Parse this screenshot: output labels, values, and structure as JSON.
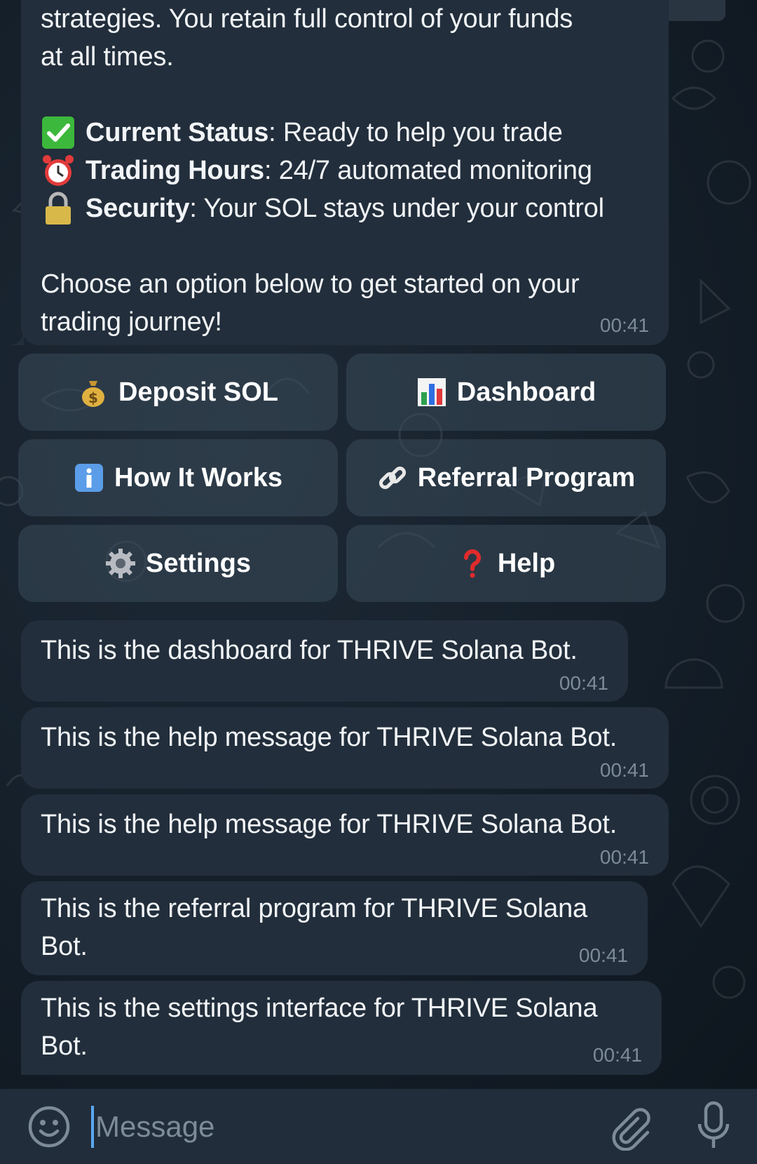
{
  "main_message": {
    "intro_line1": "strategies. You retain full control of your funds",
    "intro_line2": "at all times.",
    "status": [
      {
        "icon": "check-mark-icon",
        "label": "Current Status",
        "text": ": Ready to help you trade"
      },
      {
        "icon": "alarm-clock-icon",
        "label": "Trading Hours",
        "text": ": 24/7 automated monitoring"
      },
      {
        "icon": "lock-icon",
        "label": "Security",
        "text": ": Your SOL stays under your control"
      }
    ],
    "cta_line1": "Choose an option below to get started on your",
    "cta_line2": "trading journey!",
    "time": "00:41"
  },
  "buttons": [
    {
      "icon": "money-bag-icon",
      "label": "Deposit SOL"
    },
    {
      "icon": "bar-chart-icon",
      "label": "Dashboard"
    },
    {
      "icon": "info-icon",
      "label": "How It Works"
    },
    {
      "icon": "link-icon",
      "label": "Referral Program"
    },
    {
      "icon": "gear-icon",
      "label": "Settings"
    },
    {
      "icon": "question-mark-icon",
      "label": "Help"
    }
  ],
  "messages": [
    {
      "line1": "This is the dashboard for THRIVE Solana Bot.",
      "line2": "",
      "time": "00:41"
    },
    {
      "line1": "This is the help message for THRIVE Solana Bot.",
      "line2": "",
      "time": "00:41"
    },
    {
      "line1": "This is the help message for THRIVE Solana Bot.",
      "line2": "",
      "time": "00:41"
    },
    {
      "line1": "This is the referral program for THRIVE Solana",
      "line2": "Bot.",
      "time": "00:41"
    },
    {
      "line1": "This is the settings interface for THRIVE Solana",
      "line2": "Bot.",
      "time": "00:41"
    }
  ],
  "composer": {
    "placeholder": "Message",
    "emoji_icon": "smiley-icon",
    "attach_icon": "paperclip-icon",
    "mic_icon": "microphone-icon"
  },
  "colors": {
    "bubble": "#222e3b",
    "background": "#16212c",
    "button": "#3a4a5a",
    "timestamp": "#7d8b99",
    "accent": "#5aa8f2"
  }
}
